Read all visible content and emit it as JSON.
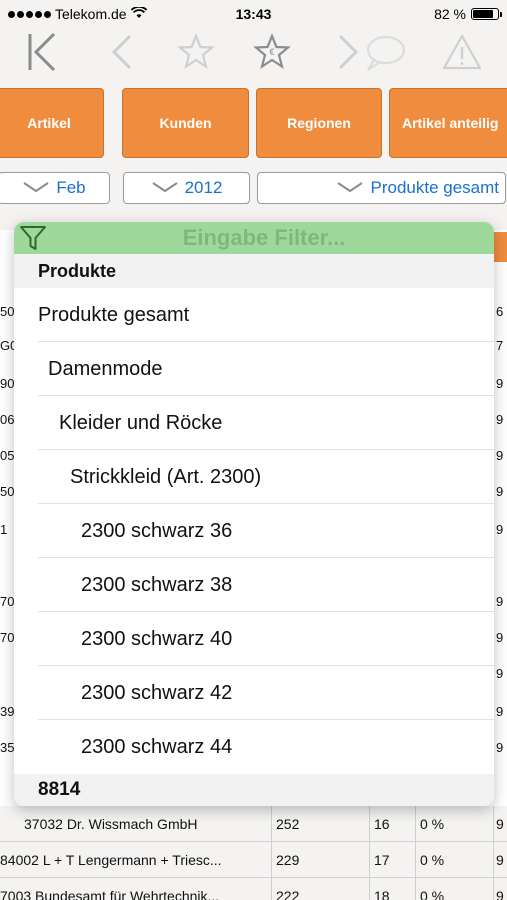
{
  "status_bar": {
    "carrier": "Telekom.de",
    "time": "13:43",
    "battery": "82 %",
    "battery_level": 0.82
  },
  "toolbar": {
    "icons": [
      "back-to-start-icon",
      "back-icon",
      "star-icon",
      "euro-star-icon",
      "forward-icon",
      "comment-icon",
      "warning-icon"
    ]
  },
  "tabs": [
    "Artikel",
    "Kunden",
    "Regionen",
    "Artikel anteilig"
  ],
  "selects": {
    "month": "Feb",
    "year": "2012",
    "product": "Produkte gesamt"
  },
  "dropdown": {
    "filter_placeholder": "Eingabe Filter...",
    "header": "Produkte",
    "footer": "8814",
    "items": [
      {
        "label": "Produkte gesamt"
      },
      {
        "label": "Damenmode"
      },
      {
        "label": "Kleider und Röcke"
      },
      {
        "label": "Strickkleid (Art. 2300)"
      },
      {
        "label": "2300 schwarz 36"
      },
      {
        "label": "2300 schwarz 38"
      },
      {
        "label": "2300 schwarz 40"
      },
      {
        "label": "2300 schwarz 42"
      },
      {
        "label": "2300 schwarz 44"
      }
    ]
  },
  "background_table": {
    "left_edge": [
      "50",
      "G0",
      "90",
      "06",
      "05",
      "50",
      "1",
      "",
      "70",
      "70",
      "",
      "39",
      "35"
    ],
    "right_edge": [
      "6",
      "7",
      "9",
      "9",
      "9",
      "9",
      "9",
      "",
      "9",
      "9",
      "9",
      "9",
      "9"
    ],
    "rows": [
      {
        "customer": "37032 Dr. Wissmach GmbH",
        "value": "252",
        "count": "16",
        "pct": "0 %",
        "edge": "9"
      },
      {
        "customer": "84002 L + T Lengermann + Triesc...",
        "value": "229",
        "count": "17",
        "pct": "0 %",
        "edge": "9"
      },
      {
        "customer": "7003 Bundesamt für Wehrtechnik...",
        "value": "222",
        "count": "18",
        "pct": "0 %",
        "edge": "9"
      }
    ]
  },
  "colors": {
    "tab_orange": "#ef8c3e",
    "filter_green": "#9ed89a",
    "link_blue": "#1b6fd0"
  }
}
